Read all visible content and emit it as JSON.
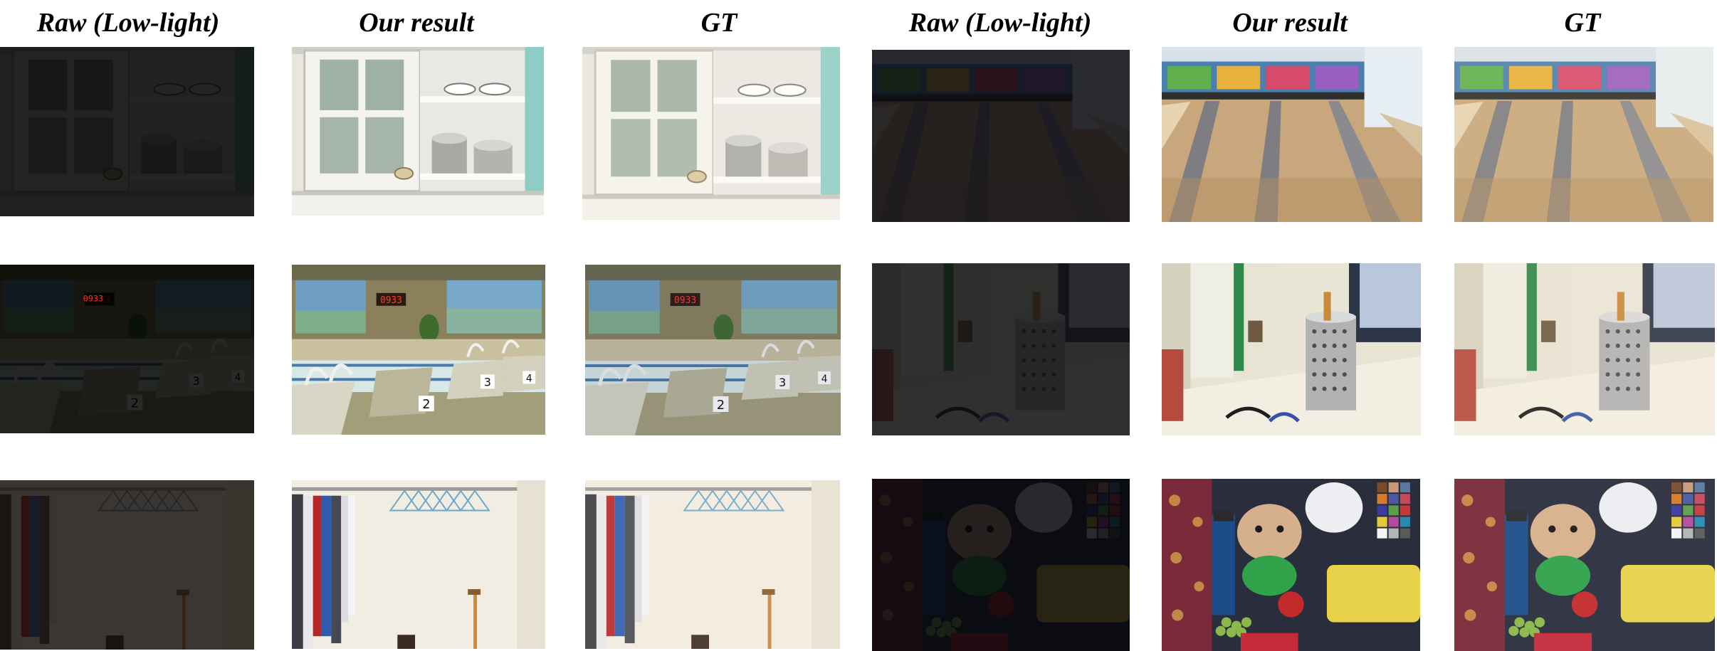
{
  "figure": {
    "column_headers": [
      "Raw (Low-light)",
      "Our result",
      "GT",
      "Raw (Low-light)",
      "Our result",
      "GT"
    ],
    "rows": [
      {
        "left_scene": "kitchen cabinet with dishes and pots",
        "right_scene": "bowling alley lanes"
      },
      {
        "left_scene": "indoor swimming pool with starting blocks",
        "right_scene": "pen holder on windowsill"
      },
      {
        "left_scene": "closet with clothes and hangers",
        "right_scene": "toys and color checker"
      }
    ],
    "column_types": [
      "raw",
      "result",
      "gt",
      "raw",
      "result",
      "gt"
    ],
    "digital_clock_text": "0933",
    "lane_numbers": [
      "2",
      "3",
      "4"
    ]
  }
}
